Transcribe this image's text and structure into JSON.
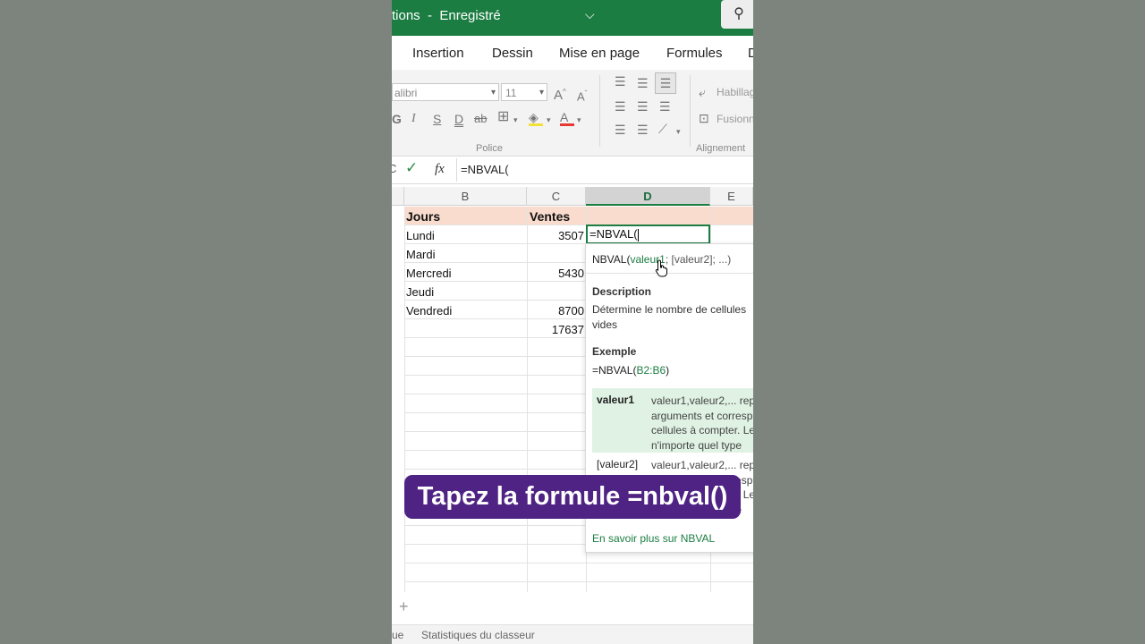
{
  "titlebar": {
    "title_fragment": "tions",
    "separator": "-",
    "status": "Enregistré",
    "chevron": "⌵",
    "search_icon": "⚲"
  },
  "menu": {
    "items": [
      "Insertion",
      "Dessin",
      "Mise en page",
      "Formules",
      "D"
    ]
  },
  "ribbon": {
    "font_name": "alibri",
    "font_size": "11",
    "increase_font": "A",
    "decrease_font": "A",
    "bold": "G",
    "italic": "I",
    "underline": "S",
    "double_underline": "D",
    "strikethrough": "ab",
    "font_color": "A",
    "wrap_text": "Habillag",
    "merge": "Fusionn",
    "group_police": "Police",
    "group_alignment": "Alignement"
  },
  "formula_bar": {
    "cancel_glyph": "C",
    "check_glyph": "✓",
    "fx": "fx",
    "value": "=NBVAL("
  },
  "columns": [
    "B",
    "C",
    "D",
    "E"
  ],
  "table": {
    "header": {
      "jours": "Jours",
      "ventes": "Ventes"
    },
    "rows": [
      {
        "day": "Lundi",
        "sales": "3507"
      },
      {
        "day": "Mardi",
        "sales": ""
      },
      {
        "day": "Mercredi",
        "sales": "5430"
      },
      {
        "day": "Jeudi",
        "sales": ""
      },
      {
        "day": "Vendredi",
        "sales": "8700"
      }
    ],
    "total": "17637"
  },
  "edit_cell": {
    "value": "=NBVAL("
  },
  "tooltip": {
    "signature_fn": "NBVAL(",
    "signature_arg": "valeur1",
    "signature_rest": "; [valeur2]; ...)",
    "description_title": "Description",
    "description_text": "Détermine le nombre de cellules vides",
    "example_title": "Exemple",
    "example_prefix": "=NBVAL(",
    "example_range": "B2:B6",
    "example_suffix": ")",
    "args": [
      {
        "name": "valeur1",
        "desc": "valeur1,valeur2,... rep arguments et corresp cellules à compter. Le n'importe quel type"
      },
      {
        "name": "[valeur2]",
        "desc": "valeur1,valeur2,... rep arguments et corresp cellules à compter. Le n'importe quel type"
      }
    ],
    "link": "En savoir plus sur NBVAL"
  },
  "sheet": {
    "add_sheet": "+"
  },
  "statusbar": {
    "left_fragment": "ue",
    "stats": "Statistiques du classeur"
  },
  "caption": "Tapez la formule =nbval()",
  "colors": {
    "excel_green": "#1b7d42",
    "header_fill": "#f9dccd",
    "caption_bg": "#4f2383",
    "backdrop": "#7d847e"
  }
}
